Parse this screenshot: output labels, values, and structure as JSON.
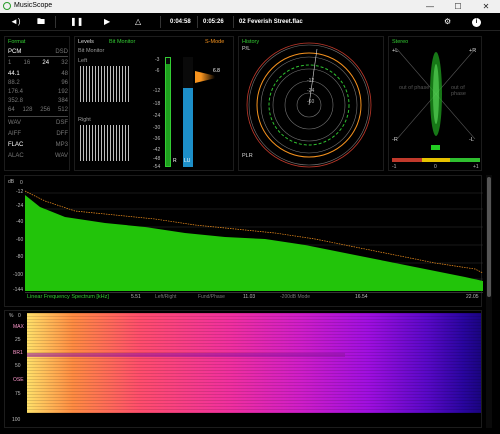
{
  "app": {
    "title": "MusicScope"
  },
  "toolbar": {
    "time_current": "0:04:58",
    "time_total": "0:05:26",
    "track": "02 Feverish Street.flac"
  },
  "format": {
    "label": "Format",
    "pcm": "PCM",
    "dsd": "DSD",
    "bits": [
      "1",
      "16",
      "24",
      "32"
    ],
    "rates": [
      [
        "44.1",
        "48"
      ],
      [
        "88.2",
        "96"
      ],
      [
        "176.4",
        "192"
      ],
      [
        "352.8",
        "384"
      ]
    ],
    "dsd_rates": [
      "64",
      "128",
      "256",
      "512"
    ],
    "codecs": [
      [
        "WAV",
        "DSF"
      ],
      [
        "AIFF",
        "DFF"
      ],
      [
        "FLAC",
        "MP3"
      ],
      [
        "ALAC",
        "WAV"
      ]
    ]
  },
  "levels": {
    "label": "Levels",
    "mode": "Bit Monitor",
    "bit_monitor": "Bit Monitor",
    "left": "Left",
    "right": "Right",
    "scale": [
      "-3",
      "-6",
      "-12",
      "-18",
      "-24",
      "-30",
      "-36",
      "-42",
      "-48",
      "-54",
      "-60"
    ],
    "s_mode": "S-Mode",
    "readout": "6.8",
    "ch_r": "R",
    "ch_l": "L",
    "ch_lu": "LU"
  },
  "history": {
    "label": "History",
    "pl": "P/L",
    "plr": "PLR",
    "rings": [
      "-12",
      "-24",
      "-36",
      "-48",
      "-60"
    ]
  },
  "stereo": {
    "label": "Stereo",
    "pl": "+L",
    "pr": "+R",
    "nl": "-L",
    "nr": "-R",
    "out_phase": "out of phase",
    "scale": [
      "-1",
      "0",
      "+1"
    ]
  },
  "spectrum": {
    "db_label": "dB",
    "ticks": [
      "0",
      "-12",
      "-24",
      "-40",
      "-60",
      "-80",
      "-100",
      "-144"
    ],
    "footer": "Linear Frequency Spectrum [kHz]",
    "x_ticks": [
      "5.51",
      "11.03",
      "16.54",
      "22.05"
    ],
    "options": [
      "Left/Right",
      "Fund/Phase",
      "-200dB Mode"
    ]
  },
  "spectrogram": {
    "labels": [
      "MAX",
      "BR1",
      "OSE"
    ],
    "ticks": [
      "%",
      "0",
      "25",
      "50",
      "75",
      "100"
    ]
  },
  "colors": {
    "accent_green": "#33cc33",
    "spectrum_green": "#22c40a",
    "peak_orange": "#f7931e",
    "meter_blue": "#1d8fc9"
  }
}
